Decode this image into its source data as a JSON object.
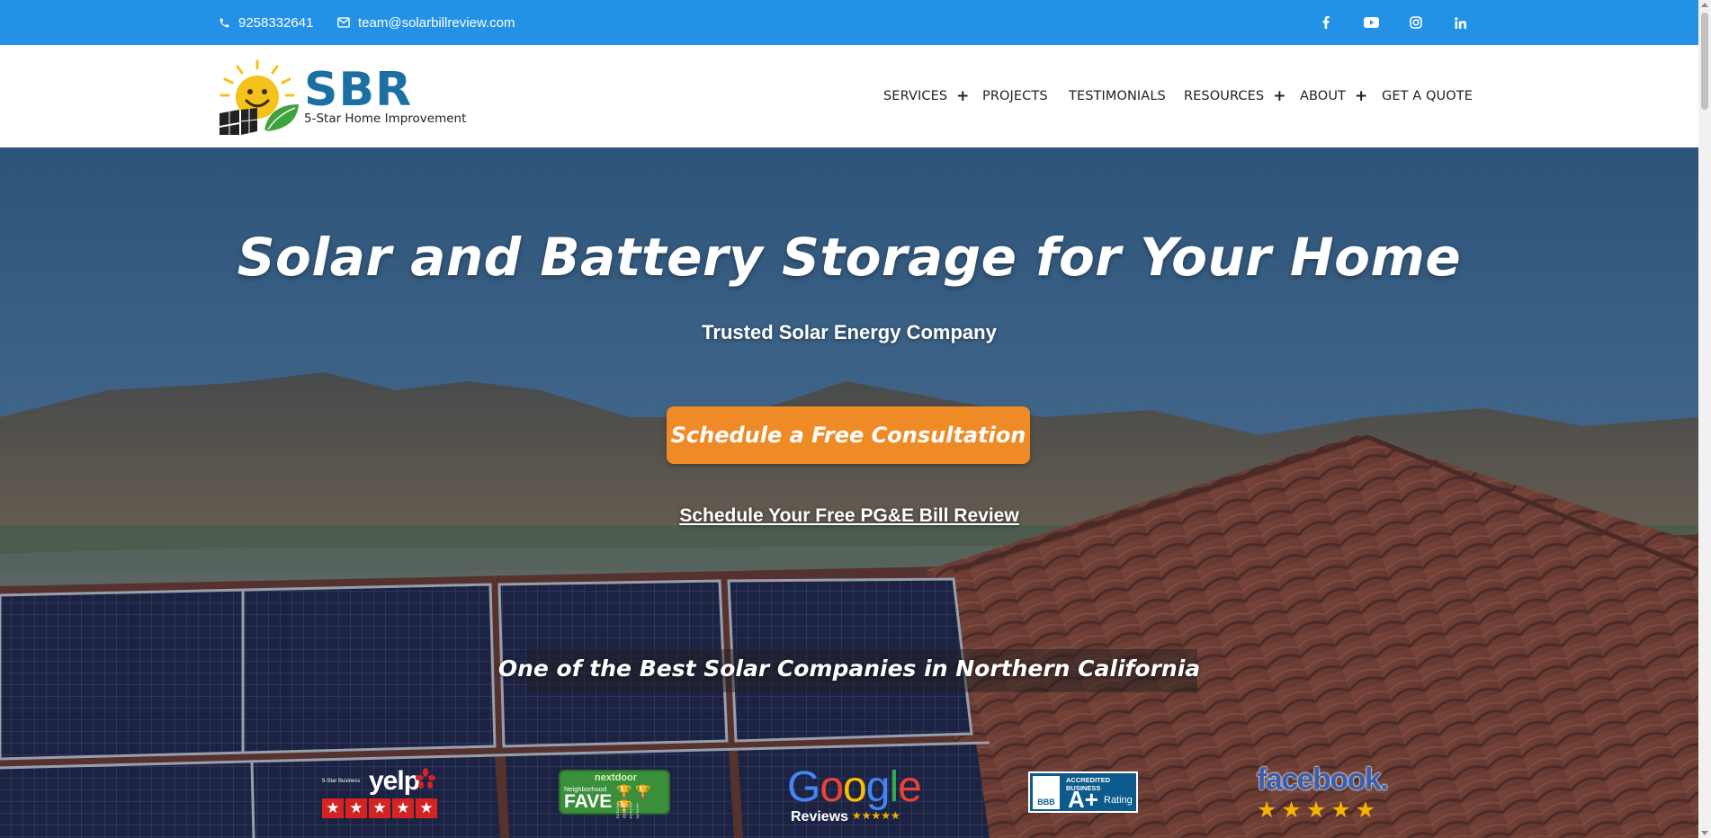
{
  "topbar": {
    "phone": "9258332641",
    "email": "team@solarbillreview.com",
    "social": [
      "facebook-icon",
      "youtube-icon",
      "instagram-icon",
      "linkedin-icon"
    ],
    "background": "#2391e6"
  },
  "logo": {
    "name": "SBR",
    "tagline": "5-Star Home Improvement"
  },
  "nav": {
    "items": [
      {
        "label": "SERVICES",
        "has_submenu": true
      },
      {
        "label": "PROJECTS",
        "has_submenu": false
      },
      {
        "label": "TESTIMONIALS",
        "has_submenu": false
      },
      {
        "label": "RESOURCES",
        "has_submenu": true
      },
      {
        "label": "ABOUT",
        "has_submenu": true
      },
      {
        "label": "GET A QUOTE",
        "has_submenu": false
      }
    ],
    "submenu_marker": "+"
  },
  "hero": {
    "title": "Solar and Battery Storage for Your Home",
    "subtitle": "Trusted Solar Energy Company",
    "cta_label": "Schedule a Free Consultation",
    "cta_color": "#ef8b27",
    "bill_review_link": "Schedule Your Free PG&E Bill Review",
    "tagline": "One of the Best Solar Companies in Northern California"
  },
  "badges": {
    "yelp": {
      "small_text": "5-Star Business",
      "word": "yelp",
      "stars": 5
    },
    "nextdoor": {
      "brand": "nextdoor",
      "neighborhood": "Neighborhood",
      "fave": "FAVE",
      "years": [
        "2021",
        "2022",
        "2023"
      ]
    },
    "google": {
      "word": "Google",
      "reviews": "Reviews",
      "stars": 5
    },
    "bbb": {
      "seal": "BBB",
      "accredited": "ACCREDITED BUSINESS",
      "grade": "A+",
      "rating": "Rating"
    },
    "facebook": {
      "word": "facebook.",
      "stars": 5
    }
  }
}
